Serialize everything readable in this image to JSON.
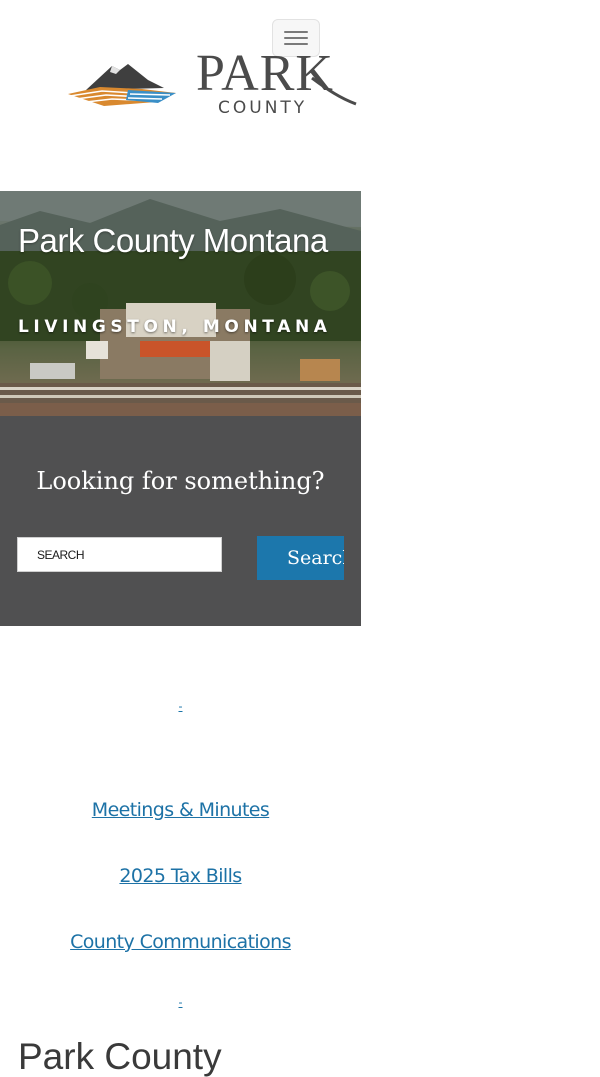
{
  "header": {
    "menu_icon": "hamburger-icon",
    "logo": {
      "word_park": "PARK",
      "word_county": "COUNTY",
      "mark_icon": "mountain-fields-logo-icon",
      "colors": {
        "mountain": "#3f3f3f",
        "field_orange": "#d9892f",
        "field_blue": "#3a8fc7",
        "text": "#4b4b4b"
      }
    }
  },
  "hero": {
    "title": "Park County Montana",
    "subtitle": "LIVINGSTON, MONTANA"
  },
  "search": {
    "heading": "Looking for something?",
    "placeholder": "SEARCH",
    "button_label": "Search",
    "icon": "search-icon",
    "colors": {
      "panel": "#505051",
      "button": "#1c77ac"
    }
  },
  "quick_links": {
    "top_spacer_link": "-",
    "items": [
      {
        "label": "Meetings & Minutes"
      },
      {
        "label": "2025 Tax Bills"
      },
      {
        "label": "County Communications"
      }
    ],
    "bottom_spacer_link": "-",
    "link_color": "#1d72a6"
  },
  "section": {
    "heading": "Park County"
  }
}
